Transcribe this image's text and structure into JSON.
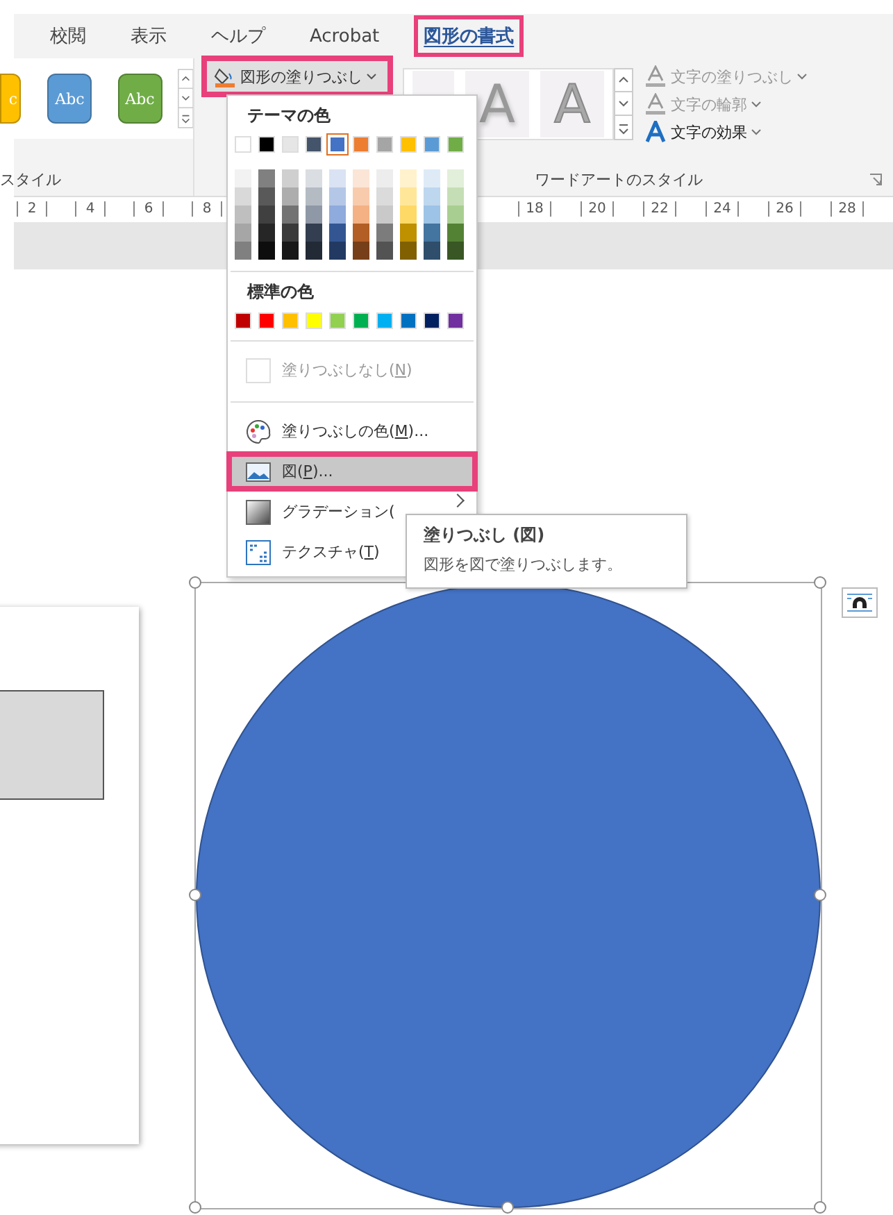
{
  "ribbon_tabs": [
    {
      "label": "校閲",
      "selected": false,
      "highlighted": false
    },
    {
      "label": "表示",
      "selected": false,
      "highlighted": false
    },
    {
      "label": "ヘルプ",
      "selected": false,
      "highlighted": false
    },
    {
      "label": "Acrobat",
      "selected": false,
      "highlighted": false
    },
    {
      "label": "図形の書式",
      "selected": true,
      "highlighted": true
    }
  ],
  "shape_styles": {
    "group_label": "スタイル",
    "presets": [
      {
        "label": "c",
        "color": "#ffc000"
      },
      {
        "label": "Abc",
        "color": "#5b9bd5"
      },
      {
        "label": "Abc",
        "color": "#70ad47"
      }
    ]
  },
  "fill_button": {
    "label": "図形の塗りつぶし",
    "highlighted": true
  },
  "wordart_styles": {
    "group_label": "ワードアートのスタイル",
    "presets": [
      {
        "label": "A",
        "kind": "shadow"
      },
      {
        "label": "A",
        "kind": "outline"
      }
    ],
    "commands": [
      {
        "label": "文字の塗りつぶし",
        "kind": "fill",
        "disabled": true
      },
      {
        "label": "文字の輪郭",
        "kind": "outline",
        "disabled": true
      },
      {
        "label": "文字の効果",
        "kind": "effects",
        "disabled": false
      }
    ]
  },
  "ruler": {
    "left_marks": [
      "2",
      "4",
      "6",
      "8"
    ],
    "right_marks": [
      "18",
      "20",
      "22",
      "24",
      "26",
      "28"
    ]
  },
  "fill_menu": {
    "theme_title": "テーマの色",
    "theme_colors": [
      {
        "color": "#ffffff",
        "selected": false
      },
      {
        "color": "#000000",
        "selected": false
      },
      {
        "color": "#e7e6e6",
        "selected": false
      },
      {
        "color": "#44546a",
        "selected": false
      },
      {
        "color": "#4472c4",
        "selected": true
      },
      {
        "color": "#ed7d31",
        "selected": false
      },
      {
        "color": "#a5a5a5",
        "selected": false
      },
      {
        "color": "#ffc000",
        "selected": false
      },
      {
        "color": "#5b9bd5",
        "selected": false
      },
      {
        "color": "#70ad47",
        "selected": false
      }
    ],
    "standard_title": "標準の色",
    "standard_colors": [
      {
        "color": "#c00000"
      },
      {
        "color": "#ff0000"
      },
      {
        "color": "#ffc000"
      },
      {
        "color": "#ffff00"
      },
      {
        "color": "#92d050"
      },
      {
        "color": "#00b050"
      },
      {
        "color": "#00b0f0"
      },
      {
        "color": "#0070c0"
      },
      {
        "color": "#002060"
      },
      {
        "color": "#7030a0"
      }
    ],
    "items": [
      {
        "kind": "no-fill",
        "text": "塗りつぶしなし(",
        "access_key": "N",
        "text_after": ")",
        "disabled": true,
        "highlighted": false,
        "submenu": false
      },
      {
        "kind": "more-colors",
        "text": "塗りつぶしの色(",
        "access_key": "M",
        "text_after": ")...",
        "disabled": false,
        "highlighted": false,
        "submenu": false
      },
      {
        "kind": "picture",
        "text": "図(",
        "access_key": "P",
        "text_after": ")...",
        "disabled": false,
        "highlighted": true,
        "submenu": false
      },
      {
        "kind": "gradient",
        "text": "グラデーション(",
        "disabled": false,
        "highlighted": false,
        "submenu": true
      },
      {
        "kind": "texture",
        "text": "テクスチャ(",
        "access_key": "T",
        "text_after": ")",
        "disabled": false,
        "highlighted": false
      }
    ]
  },
  "tooltip": {
    "title": "塗りつぶし (図)",
    "description": "図形を図で塗りつぶします。"
  },
  "canvas": {
    "circle": {
      "color": "#4472c4",
      "selected": true
    }
  }
}
